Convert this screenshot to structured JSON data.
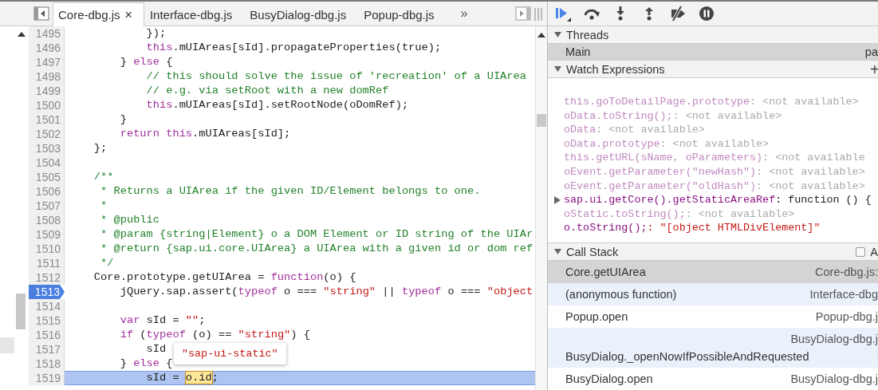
{
  "editor": {
    "tabs": [
      {
        "label": "Core-dbg.js",
        "selected": true,
        "close": "×"
      },
      {
        "label": "Interface-dbg.js",
        "selected": false
      },
      {
        "label": "BusyDialog-dbg.js",
        "selected": false
      },
      {
        "label": "Popup-dbg.js",
        "selected": false
      }
    ],
    "tab_overflow": "»",
    "lines": [
      {
        "number": "1495",
        "breakpoint": false,
        "selected": false,
        "tokens": [
          {
            "kind": "plain",
            "text": "            });"
          }
        ]
      },
      {
        "number": "1496",
        "breakpoint": false,
        "selected": false,
        "tokens": [
          {
            "kind": "keyword",
            "text": "            this"
          },
          {
            "kind": "plain",
            "text": ".mUIAreas[sId].propagateProperties(true);"
          }
        ]
      },
      {
        "number": "1497",
        "breakpoint": false,
        "selected": false,
        "tokens": [
          {
            "kind": "plain",
            "text": "        } "
          },
          {
            "kind": "keyword",
            "text": "else"
          },
          {
            "kind": "plain",
            "text": " {"
          }
        ]
      },
      {
        "number": "1498",
        "breakpoint": false,
        "selected": false,
        "tokens": [
          {
            "kind": "comment",
            "text": "            // this should solve the issue of 'recreation' of a UIArea"
          }
        ]
      },
      {
        "number": "1499",
        "breakpoint": false,
        "selected": false,
        "tokens": [
          {
            "kind": "comment",
            "text": "            // e.g. via setRoot with a new domRef"
          }
        ]
      },
      {
        "number": "1500",
        "breakpoint": false,
        "selected": false,
        "tokens": [
          {
            "kind": "keyword",
            "text": "            this"
          },
          {
            "kind": "plain",
            "text": ".mUIAreas[sId].setRootNode(oDomRef);"
          }
        ]
      },
      {
        "number": "1501",
        "breakpoint": false,
        "selected": false,
        "tokens": [
          {
            "kind": "plain",
            "text": "        }"
          }
        ]
      },
      {
        "number": "1502",
        "breakpoint": false,
        "selected": false,
        "tokens": [
          {
            "kind": "keyword",
            "text": "        return this"
          },
          {
            "kind": "plain",
            "text": ".mUIAreas[sId];"
          }
        ]
      },
      {
        "number": "1503",
        "breakpoint": false,
        "selected": false,
        "tokens": [
          {
            "kind": "plain",
            "text": "    };"
          }
        ]
      },
      {
        "number": "1504",
        "breakpoint": false,
        "selected": false
      },
      {
        "number": "1505",
        "breakpoint": false,
        "selected": false,
        "tokens": [
          {
            "kind": "comment",
            "text": "    /**"
          }
        ]
      },
      {
        "number": "1506",
        "breakpoint": false,
        "selected": false,
        "tokens": [
          {
            "kind": "comment",
            "text": "     * Returns a UIArea if the given ID/Element belongs to one."
          }
        ]
      },
      {
        "number": "1507",
        "breakpoint": false,
        "selected": false,
        "tokens": [
          {
            "kind": "comment",
            "text": "     *"
          }
        ]
      },
      {
        "number": "1508",
        "breakpoint": false,
        "selected": false,
        "tokens": [
          {
            "kind": "comment",
            "text": "     * @public"
          }
        ]
      },
      {
        "number": "1509",
        "breakpoint": false,
        "selected": false,
        "tokens": [
          {
            "kind": "comment",
            "text": "     * @param {string|Element} o a DOM Element or ID string of the UIAr"
          }
        ]
      },
      {
        "number": "1510",
        "breakpoint": false,
        "selected": false,
        "tokens": [
          {
            "kind": "comment",
            "text": "     * @return {sap.ui.core.UIArea} a UIArea with a given id or dom ref"
          }
        ]
      },
      {
        "number": "1511",
        "breakpoint": false,
        "selected": false,
        "tokens": [
          {
            "kind": "comment",
            "text": "     */"
          }
        ]
      },
      {
        "number": "1512",
        "breakpoint": false,
        "selected": false,
        "tokens": [
          {
            "kind": "plain",
            "text": "    Core.prototype.getUIArea = "
          },
          {
            "kind": "keyword",
            "text": "function"
          },
          {
            "kind": "plain",
            "text": "(o) {"
          }
        ]
      },
      {
        "number": "1513",
        "breakpoint": true,
        "selected": false,
        "tokens": [
          {
            "kind": "plain",
            "text": "        jQuery.sap.assert("
          },
          {
            "kind": "keyword",
            "text": "typeof"
          },
          {
            "kind": "plain",
            "text": " o === "
          },
          {
            "kind": "string",
            "text": "\"string\""
          },
          {
            "kind": "plain",
            "text": " || "
          },
          {
            "kind": "keyword",
            "text": "typeof"
          },
          {
            "kind": "plain",
            "text": " o === "
          },
          {
            "kind": "string",
            "text": "\"object"
          }
        ]
      },
      {
        "number": "1514",
        "breakpoint": false,
        "selected": false
      },
      {
        "number": "1515",
        "breakpoint": false,
        "selected": false,
        "tokens": [
          {
            "kind": "keyword",
            "text": "        var"
          },
          {
            "kind": "plain",
            "text": " sId = "
          },
          {
            "kind": "string",
            "text": "\"\""
          },
          {
            "kind": "plain",
            "text": ";"
          }
        ]
      },
      {
        "number": "1516",
        "breakpoint": false,
        "selected": false,
        "tokens": [
          {
            "kind": "keyword",
            "text": "        if"
          },
          {
            "kind": "plain",
            "text": " ("
          },
          {
            "kind": "keyword",
            "text": "typeof"
          },
          {
            "kind": "plain",
            "text": " (o) == "
          },
          {
            "kind": "string",
            "text": "\"string\""
          },
          {
            "kind": "plain",
            "text": ") {"
          }
        ]
      },
      {
        "number": "1517",
        "breakpoint": false,
        "selected": false,
        "tokens": [
          {
            "kind": "plain",
            "text": "            sId"
          }
        ]
      },
      {
        "number": "1518",
        "breakpoint": false,
        "selected": false,
        "tokens": [
          {
            "kind": "plain",
            "text": "        } "
          },
          {
            "kind": "keyword",
            "text": "else"
          },
          {
            "kind": "plain",
            "text": " {"
          }
        ]
      },
      {
        "number": "1519",
        "breakpoint": false,
        "selected": true,
        "tokens": [
          {
            "kind": "plain",
            "text": "            sId = "
          },
          {
            "kind": "hover",
            "text": "o.id"
          },
          {
            "kind": "plain",
            "text": ";"
          }
        ]
      }
    ],
    "tooltip": {
      "text": "\"sap-ui-static\""
    }
  },
  "sidebar": {
    "threads": {
      "title": "Threads",
      "expanded": true,
      "items": [
        {
          "name": "Main",
          "status": "pa",
          "selected": true
        }
      ]
    },
    "watch": {
      "title": "Watch Expressions",
      "expanded": true,
      "add": "+",
      "items": [
        {
          "expression": "this.goToDetailPage.prototype",
          "value": ": <not available>",
          "kind": "unavailable"
        },
        {
          "expression": "oData.toString();",
          "value": ": <not available>",
          "kind": "unavailable"
        },
        {
          "expression": "oData",
          "value": ": <not available>",
          "kind": "unavailable"
        },
        {
          "expression": "oData.prototype",
          "value": ": <not available>",
          "kind": "unavailable"
        },
        {
          "expression": "this.getURL(sName, oParameters)",
          "value": ": <not available",
          "kind": "unavailable"
        },
        {
          "expression": "oEvent.getParameter(\"newHash\")",
          "value": ": <not available>",
          "kind": "unavailable"
        },
        {
          "expression": "oEvent.getParameter(\"oldHash\")",
          "value": ": <not available>",
          "kind": "unavailable"
        },
        {
          "expression": "sap.ui.getCore().getStaticAreaRef",
          "value": ": function () {",
          "kind": "object"
        },
        {
          "expression": "oStatic.toString();",
          "value": ": <not available>",
          "kind": "unavailable"
        },
        {
          "expression": "o.toString();",
          "value": ": \"[object HTMLDivElement]\"",
          "kind": "string"
        }
      ]
    },
    "call_stack": {
      "title": "Call Stack",
      "expanded": true,
      "option": {
        "label": "A",
        "checked": false
      },
      "frames": [
        {
          "function": "Core.getUIArea",
          "location": "Core-dbg.js:",
          "selected": true
        },
        {
          "function": "(anonymous function)",
          "location": "Interface-dbg",
          "selected": false
        },
        {
          "function": "Popup.open",
          "location": "Popup-dbg.j",
          "selected": false
        },
        {
          "function": "BusyDialog._openNowIfPossibleAndRequested",
          "location": "BusyDialog-dbg.j",
          "selected": false
        },
        {
          "function": "BusyDialog.open",
          "location": "BusyDialog-dbg.j",
          "selected": false
        }
      ]
    }
  }
}
